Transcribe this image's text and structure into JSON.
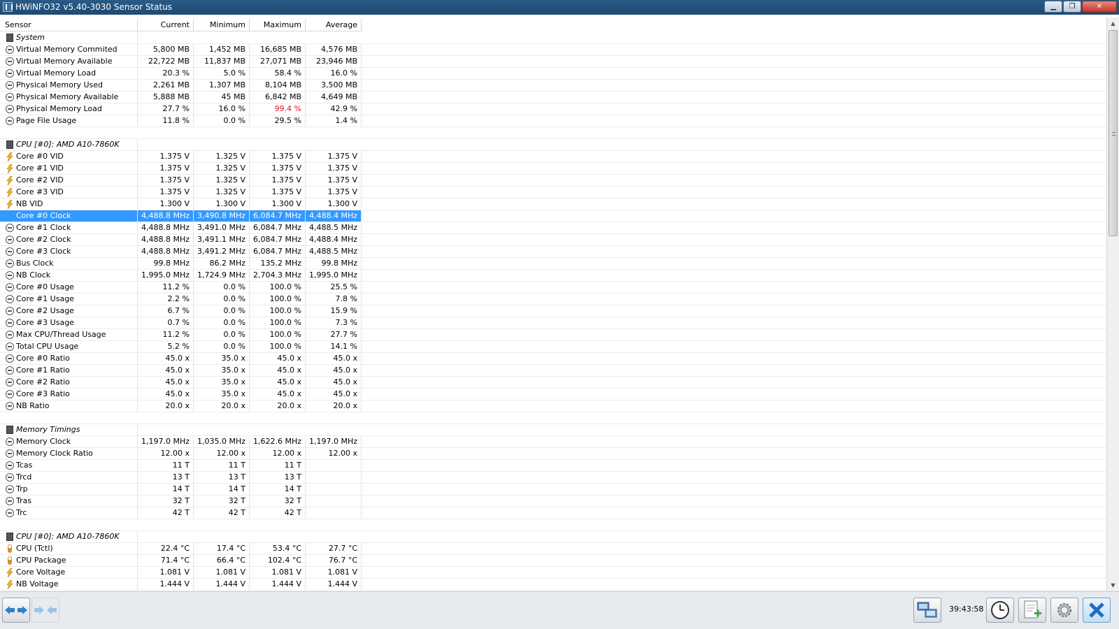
{
  "window": {
    "title": "HWiNFO32 v5.40-3030 Sensor Status"
  },
  "columns": {
    "sensor": "Sensor",
    "current": "Current",
    "minimum": "Minimum",
    "maximum": "Maximum",
    "average": "Average"
  },
  "rows": [
    {
      "type": "group",
      "name": "System"
    },
    {
      "icon": "clock",
      "name": "Virtual Memory Commited",
      "cur": "5,800 MB",
      "min": "1,452 MB",
      "max": "16,685 MB",
      "avg": "4,576 MB"
    },
    {
      "icon": "clock",
      "name": "Virtual Memory Available",
      "cur": "22,722 MB",
      "min": "11,837 MB",
      "max": "27,071 MB",
      "avg": "23,946 MB"
    },
    {
      "icon": "clock",
      "name": "Virtual Memory Load",
      "cur": "20.3 %",
      "min": "5.0 %",
      "max": "58.4 %",
      "avg": "16.0 %"
    },
    {
      "icon": "clock",
      "name": "Physical Memory Used",
      "cur": "2,261 MB",
      "min": "1,307 MB",
      "max": "8,104 MB",
      "avg": "3,500 MB"
    },
    {
      "icon": "clock",
      "name": "Physical Memory Available",
      "cur": "5,888 MB",
      "min": "45 MB",
      "max": "6,842 MB",
      "avg": "4,649 MB"
    },
    {
      "icon": "clock",
      "name": "Physical Memory Load",
      "cur": "27.7 %",
      "min": "16.0 %",
      "max": "99.4 %",
      "avg": "42.9 %",
      "max_color": "#e81123"
    },
    {
      "icon": "clock",
      "name": "Page File Usage",
      "cur": "11.8 %",
      "min": "0.0 %",
      "max": "29.5 %",
      "avg": "1.4 %"
    },
    {
      "type": "blank"
    },
    {
      "type": "group",
      "name": "CPU [#0]: AMD A10-7860K"
    },
    {
      "icon": "bolt",
      "name": "Core #0 VID",
      "cur": "1.375 V",
      "min": "1.325 V",
      "max": "1.375 V",
      "avg": "1.375 V"
    },
    {
      "icon": "bolt",
      "name": "Core #1 VID",
      "cur": "1.375 V",
      "min": "1.325 V",
      "max": "1.375 V",
      "avg": "1.375 V"
    },
    {
      "icon": "bolt",
      "name": "Core #2 VID",
      "cur": "1.375 V",
      "min": "1.325 V",
      "max": "1.375 V",
      "avg": "1.375 V"
    },
    {
      "icon": "bolt",
      "name": "Core #3 VID",
      "cur": "1.375 V",
      "min": "1.325 V",
      "max": "1.375 V",
      "avg": "1.375 V"
    },
    {
      "icon": "bolt",
      "name": "NB VID",
      "cur": "1.300 V",
      "min": "1.300 V",
      "max": "1.300 V",
      "avg": "1.300 V"
    },
    {
      "icon": "clock",
      "name": "Core #0 Clock",
      "cur": "4,488.8 MHz",
      "min": "3,490.8 MHz",
      "max": "6,084.7 MHz",
      "avg": "4,488.4 MHz",
      "selected": true
    },
    {
      "icon": "clock",
      "name": "Core #1 Clock",
      "cur": "4,488.8 MHz",
      "min": "3,491.0 MHz",
      "max": "6,084.7 MHz",
      "avg": "4,488.5 MHz"
    },
    {
      "icon": "clock",
      "name": "Core #2 Clock",
      "cur": "4,488.8 MHz",
      "min": "3,491.1 MHz",
      "max": "6,084.7 MHz",
      "avg": "4,488.4 MHz"
    },
    {
      "icon": "clock",
      "name": "Core #3 Clock",
      "cur": "4,488.8 MHz",
      "min": "3,491.2 MHz",
      "max": "6,084.7 MHz",
      "avg": "4,488.5 MHz"
    },
    {
      "icon": "clock",
      "name": "Bus Clock",
      "cur": "99.8 MHz",
      "min": "86.2 MHz",
      "max": "135.2 MHz",
      "avg": "99.8 MHz"
    },
    {
      "icon": "clock",
      "name": "NB Clock",
      "cur": "1,995.0 MHz",
      "min": "1,724.9 MHz",
      "max": "2,704.3 MHz",
      "avg": "1,995.0 MHz"
    },
    {
      "icon": "clock",
      "name": "Core #0 Usage",
      "cur": "11.2 %",
      "min": "0.0 %",
      "max": "100.0 %",
      "avg": "25.5 %"
    },
    {
      "icon": "clock",
      "name": "Core #1 Usage",
      "cur": "2.2 %",
      "min": "0.0 %",
      "max": "100.0 %",
      "avg": "7.8 %"
    },
    {
      "icon": "clock",
      "name": "Core #2 Usage",
      "cur": "6.7 %",
      "min": "0.0 %",
      "max": "100.0 %",
      "avg": "15.9 %"
    },
    {
      "icon": "clock",
      "name": "Core #3 Usage",
      "cur": "0.7 %",
      "min": "0.0 %",
      "max": "100.0 %",
      "avg": "7.3 %"
    },
    {
      "icon": "clock",
      "name": "Max CPU/Thread Usage",
      "cur": "11.2 %",
      "min": "0.0 %",
      "max": "100.0 %",
      "avg": "27.7 %"
    },
    {
      "icon": "clock",
      "name": "Total CPU Usage",
      "cur": "5.2 %",
      "min": "0.0 %",
      "max": "100.0 %",
      "avg": "14.1 %"
    },
    {
      "icon": "clock",
      "name": "Core #0 Ratio",
      "cur": "45.0 x",
      "min": "35.0 x",
      "max": "45.0 x",
      "avg": "45.0 x"
    },
    {
      "icon": "clock",
      "name": "Core #1 Ratio",
      "cur": "45.0 x",
      "min": "35.0 x",
      "max": "45.0 x",
      "avg": "45.0 x"
    },
    {
      "icon": "clock",
      "name": "Core #2 Ratio",
      "cur": "45.0 x",
      "min": "35.0 x",
      "max": "45.0 x",
      "avg": "45.0 x"
    },
    {
      "icon": "clock",
      "name": "Core #3 Ratio",
      "cur": "45.0 x",
      "min": "35.0 x",
      "max": "45.0 x",
      "avg": "45.0 x"
    },
    {
      "icon": "clock",
      "name": "NB Ratio",
      "cur": "20.0 x",
      "min": "20.0 x",
      "max": "20.0 x",
      "avg": "20.0 x"
    },
    {
      "type": "blank"
    },
    {
      "type": "group",
      "name": "Memory Timings"
    },
    {
      "icon": "clock",
      "name": "Memory Clock",
      "cur": "1,197.0 MHz",
      "min": "1,035.0 MHz",
      "max": "1,622.6 MHz",
      "avg": "1,197.0 MHz"
    },
    {
      "icon": "clock",
      "name": "Memory Clock Ratio",
      "cur": "12.00 x",
      "min": "12.00 x",
      "max": "12.00 x",
      "avg": "12.00 x"
    },
    {
      "icon": "clock",
      "name": "Tcas",
      "cur": "11 T",
      "min": "11 T",
      "max": "11 T",
      "avg": ""
    },
    {
      "icon": "clock",
      "name": "Trcd",
      "cur": "13 T",
      "min": "13 T",
      "max": "13 T",
      "avg": ""
    },
    {
      "icon": "clock",
      "name": "Trp",
      "cur": "14 T",
      "min": "14 T",
      "max": "14 T",
      "avg": ""
    },
    {
      "icon": "clock",
      "name": "Tras",
      "cur": "32 T",
      "min": "32 T",
      "max": "32 T",
      "avg": ""
    },
    {
      "icon": "clock",
      "name": "Trc",
      "cur": "42 T",
      "min": "42 T",
      "max": "42 T",
      "avg": ""
    },
    {
      "type": "blank"
    },
    {
      "type": "group",
      "name": "CPU [#0]: AMD A10-7860K"
    },
    {
      "icon": "therm",
      "name": "CPU (Tctl)",
      "cur": "22.4 °C",
      "min": "17.4 °C",
      "max": "53.4 °C",
      "avg": "27.7 °C"
    },
    {
      "icon": "therm",
      "name": "CPU Package",
      "cur": "71.4 °C",
      "min": "66.4 °C",
      "max": "102.4 °C",
      "avg": "76.7 °C"
    },
    {
      "icon": "bolt",
      "name": "Core Voltage",
      "cur": "1.081 V",
      "min": "1.081 V",
      "max": "1.081 V",
      "avg": "1.081 V"
    },
    {
      "icon": "bolt",
      "name": "NB Voltage",
      "cur": "1.444 V",
      "min": "1.444 V",
      "max": "1.444 V",
      "avg": "1.444 V"
    }
  ],
  "bottombar": {
    "timer": "39:43:58"
  },
  "colors": {
    "selection": "#3399ff",
    "alert": "#e81123",
    "titlebar": "#1e4a73"
  }
}
